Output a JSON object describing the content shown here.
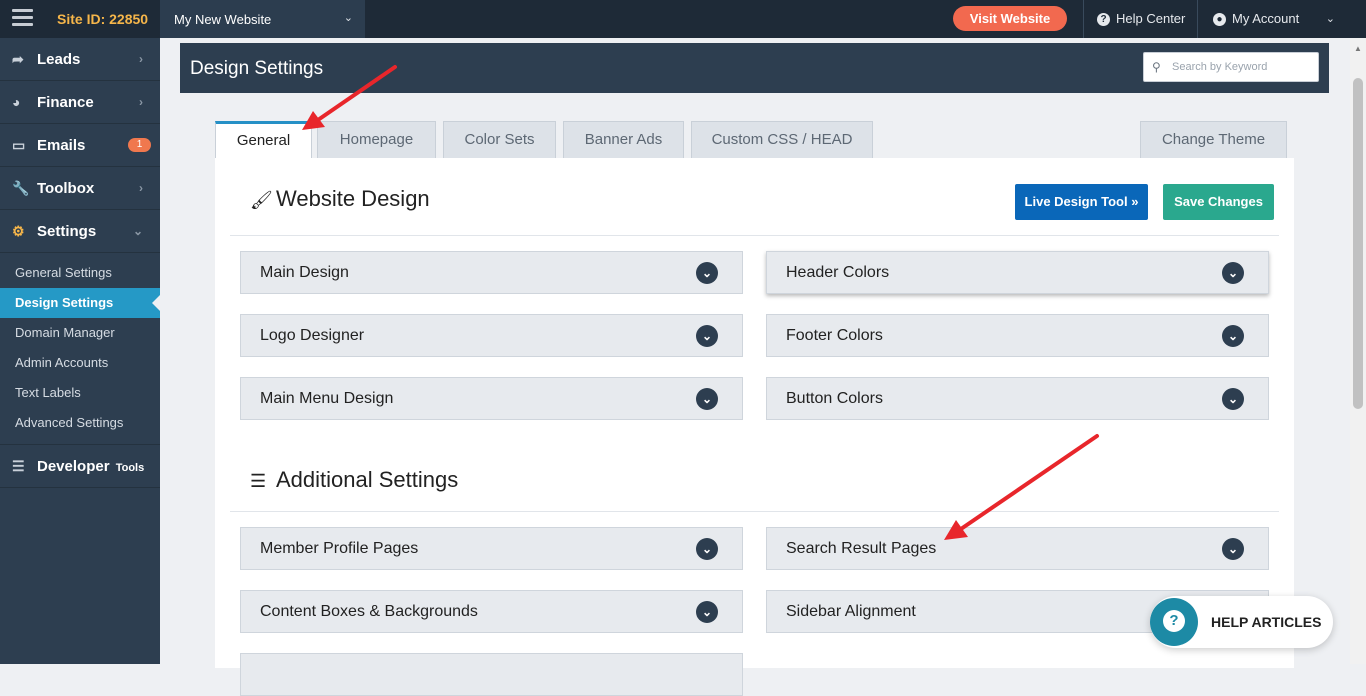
{
  "topbar": {
    "site_id": "Site ID: 22850",
    "site_name": "My New Website",
    "visit_label": "Visit Website",
    "help_center": "Help Center",
    "my_account": "My Account"
  },
  "sidebar": {
    "items": [
      {
        "label": "Leads",
        "icon": "share-arrow-icon"
      },
      {
        "label": "Finance",
        "icon": "pie-chart-icon"
      },
      {
        "label": "Emails",
        "icon": "inbox-icon",
        "badge": "1"
      },
      {
        "label": "Toolbox",
        "icon": "wrench-icon"
      },
      {
        "label": "Settings",
        "icon": "gear-icon"
      }
    ],
    "settings_sub": [
      "General Settings",
      "Design Settings",
      "Domain Manager",
      "Admin Accounts",
      "Text Labels",
      "Advanced Settings"
    ],
    "developer_label": "Developer",
    "developer_suffix": "Tools"
  },
  "header": {
    "title": "Design Settings",
    "search_placeholder": "Search by Keyword"
  },
  "tabs": [
    "General",
    "Homepage",
    "Color Sets",
    "Banner Ads",
    "Custom CSS / HEAD"
  ],
  "change_theme": "Change Theme",
  "website_design": {
    "title": "Website Design",
    "live_btn": "Live Design Tool »",
    "save_btn": "Save Changes",
    "left": [
      "Main Design",
      "Logo Designer",
      "Main Menu Design"
    ],
    "right": [
      "Header Colors",
      "Footer Colors",
      "Button Colors"
    ]
  },
  "additional": {
    "title": "Additional Settings",
    "left": [
      "Member Profile Pages",
      "Content Boxes & Backgrounds"
    ],
    "right": [
      "Search Result Pages",
      "Sidebar Alignment"
    ]
  },
  "help_articles": "HELP ARTICLES",
  "colors": {
    "topbar": "#1e2a37",
    "sidebar": "#2d3e50",
    "accent_blue": "#2599c6",
    "visit": "#f2694f",
    "site_id": "#f6b64a",
    "live_btn": "#0a67b9",
    "save_btn": "#2aa88e",
    "annotation_arrow": "#e8262b"
  }
}
